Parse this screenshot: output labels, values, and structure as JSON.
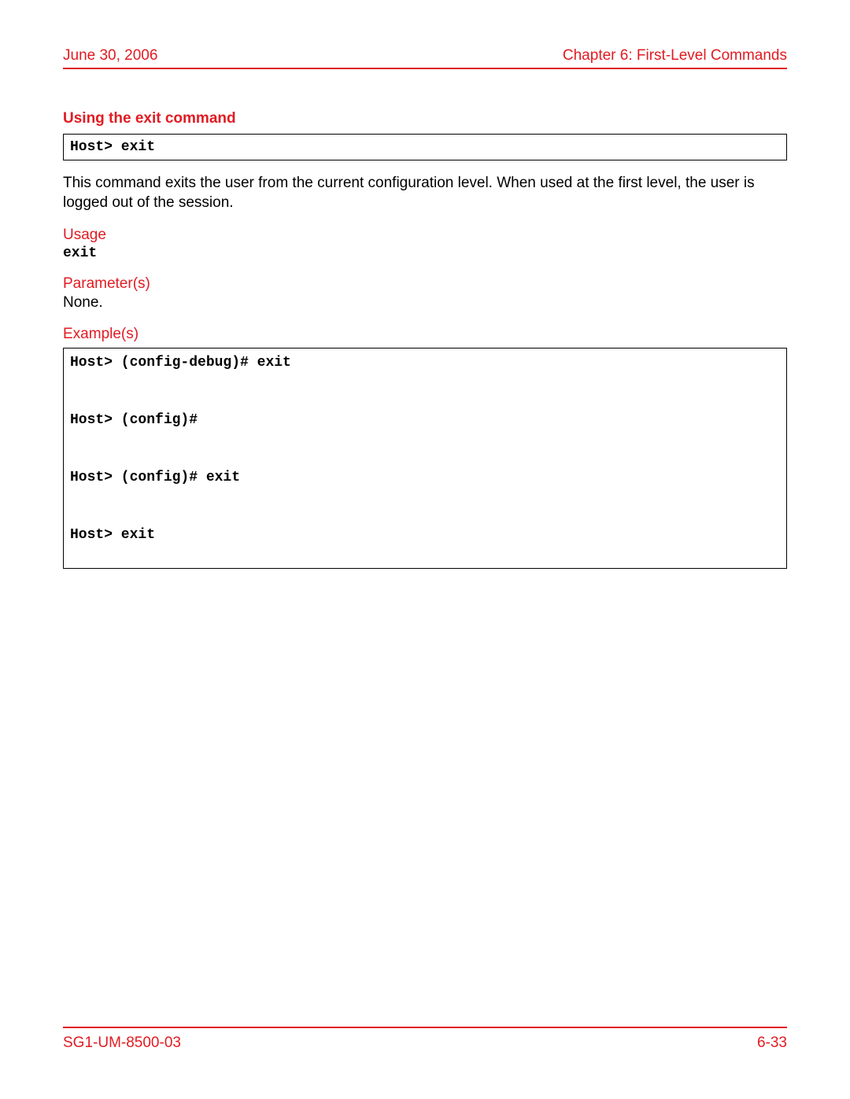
{
  "header": {
    "left": "June 30, 2006",
    "right": "Chapter 6: First-Level Commands"
  },
  "section": {
    "title": "Using the exit command",
    "syntax_box": "Host> exit",
    "description": "This command exits the user from the current configuration level. When used at the first level, the user is logged out of the session.",
    "usage_label": "Usage",
    "usage_code": "exit",
    "params_label": "Parameter(s)",
    "params_value": "None.",
    "examples_label": "Example(s)",
    "examples_code": "Host> (config-debug)# exit\n\n\nHost> (config)#\n\n\nHost> (config)# exit\n\n\nHost> exit"
  },
  "footer": {
    "left": "SG1-UM-8500-03",
    "right": "6-33"
  }
}
